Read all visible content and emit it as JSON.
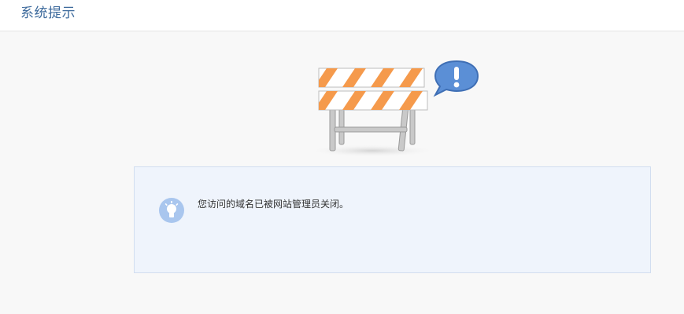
{
  "header": {
    "title": "系统提示"
  },
  "illustration": {
    "icon": "road-barrier-icon",
    "bubble_icon": "exclamation-speech-bubble-icon",
    "stripe_color": "#f59a4c",
    "bubble_color": "#5b8fd6"
  },
  "notice": {
    "icon": "lightbulb-icon",
    "message": "您访问的域名已被网站管理员关闭。",
    "background": "#eff4fc"
  }
}
